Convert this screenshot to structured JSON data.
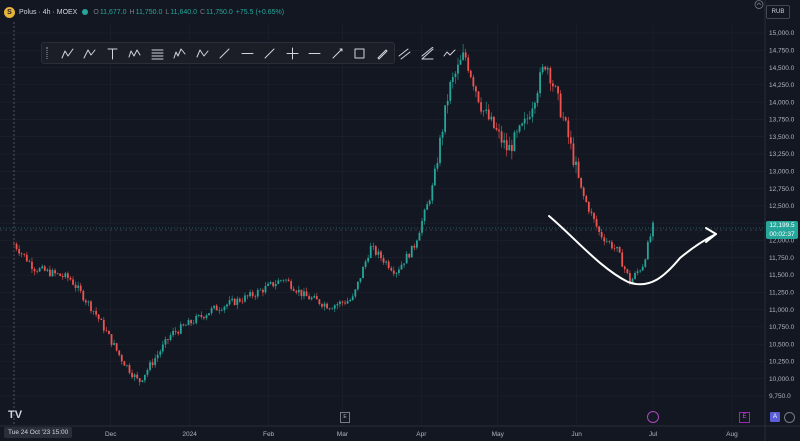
{
  "header": {
    "logo_glyph": "S",
    "title": "Polus · 4h · MOEX",
    "ohlc": [
      {
        "k": "O",
        "v": "11,677.0"
      },
      {
        "k": "H",
        "v": "11,750.0"
      },
      {
        "k": "L",
        "v": "11,640.0"
      },
      {
        "k": "C",
        "v": "11,750.0"
      }
    ],
    "change": "+75.5 (+0.65%)"
  },
  "currency": "RUB",
  "toolbar": {
    "tools": [
      "pitchfork-icon",
      "schiff-pitchfork-icon",
      "anchored-text-icon",
      "wave-icon",
      "fib-retracement-icon",
      "elliott-wave-icon",
      "abcd-pattern-icon",
      "trend-line-icon",
      "horizontal-ray-icon",
      "ray-icon",
      "cross-line-icon",
      "horizontal-line-icon",
      "info-line-icon",
      "rectangle-icon",
      "pencil-icon",
      "parallel-channel-icon",
      "fib-channel-icon",
      "path-icon"
    ]
  },
  "price_axis": {
    "labels": [
      "15,000.0",
      "14,750.0",
      "14,500.0",
      "14,250.0",
      "14,000.0",
      "13,750.0",
      "13,500.0",
      "13,250.0",
      "13,000.0",
      "12,750.0",
      "12,500.0",
      "12,250.0",
      "12,000.0",
      "11,750.0",
      "11,500.0",
      "11,250.0",
      "11,000.0",
      "10,750.0",
      "10,500.0",
      "10,250.0",
      "10,000.0",
      "9,750.0"
    ],
    "top": 15000,
    "bottom": 9750
  },
  "time_axis": {
    "labels": [
      "Dec",
      "2024",
      "Feb",
      "Mar",
      "Apr",
      "May",
      "Jun",
      "Jul",
      "Aug"
    ]
  },
  "current_price": {
    "value": "12,199.5",
    "countdown": "00:02:37"
  },
  "cursor_time": "Tue 24 Oct '23   15:00",
  "bottom_icons": {
    "e_label": "E",
    "purple_label": "E",
    "a_label": "A"
  },
  "colors": {
    "up": "#26a69a",
    "down": "#ef5350",
    "background": "#131722",
    "annotation": "#ffffff"
  },
  "chart_data": {
    "type": "candlestick",
    "y_unit": "RUB",
    "ylim": [
      9750,
      15000
    ],
    "points": [
      {
        "x": "2023-10-24",
        "close": 11950
      },
      {
        "x": "2023-11-01",
        "close": 11600
      },
      {
        "x": "2023-11-15",
        "close": 11450
      },
      {
        "x": "2023-11-25",
        "close": 10950
      },
      {
        "x": "2023-12-05",
        "close": 10300
      },
      {
        "x": "2023-12-12",
        "close": 9950
      },
      {
        "x": "2023-12-25",
        "close": 10650
      },
      {
        "x": "2024-01-10",
        "close": 11000
      },
      {
        "x": "2024-01-25",
        "close": 11200
      },
      {
        "x": "2024-02-07",
        "close": 11450
      },
      {
        "x": "2024-02-15",
        "close": 11200
      },
      {
        "x": "2024-02-25",
        "close": 11050
      },
      {
        "x": "2024-03-05",
        "close": 11150
      },
      {
        "x": "2024-03-12",
        "close": 11900
      },
      {
        "x": "2024-03-22",
        "close": 11550
      },
      {
        "x": "2024-03-29",
        "close": 11900
      },
      {
        "x": "2024-04-05",
        "close": 12700
      },
      {
        "x": "2024-04-12",
        "close": 14200
      },
      {
        "x": "2024-04-18",
        "close": 14700
      },
      {
        "x": "2024-04-25",
        "close": 13900
      },
      {
        "x": "2024-05-05",
        "close": 13300
      },
      {
        "x": "2024-05-12",
        "close": 13700
      },
      {
        "x": "2024-05-20",
        "close": 14600
      },
      {
        "x": "2024-05-28",
        "close": 13600
      },
      {
        "x": "2024-06-03",
        "close": 12700
      },
      {
        "x": "2024-06-10",
        "close": 12100
      },
      {
        "x": "2024-06-17",
        "close": 11850
      },
      {
        "x": "2024-06-22",
        "close": 11400
      },
      {
        "x": "2024-06-27",
        "close": 11650
      },
      {
        "x": "2024-07-01",
        "close": 12199.5
      }
    ]
  }
}
